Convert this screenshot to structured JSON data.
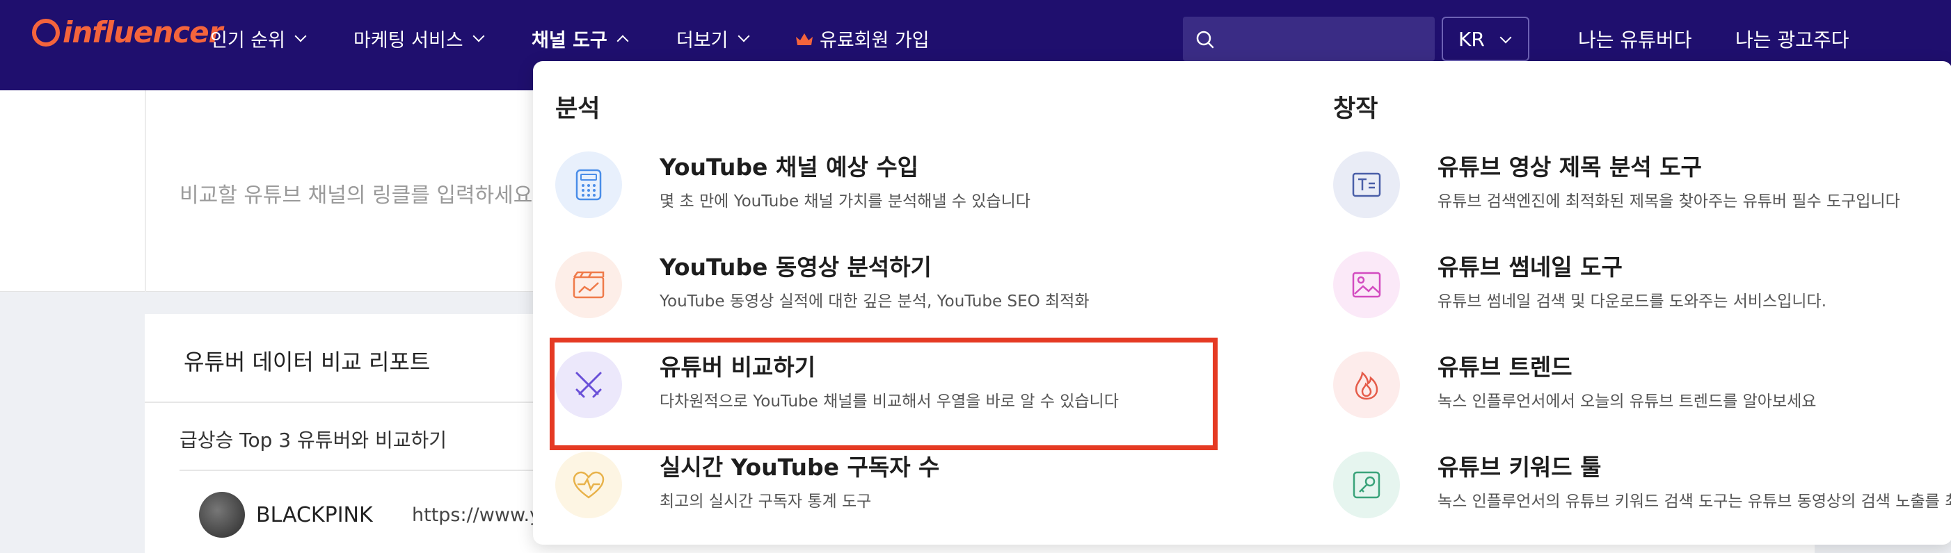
{
  "header": {
    "logo_text": "influencer",
    "nav": [
      {
        "label": "인기 순위"
      },
      {
        "label": "마케팅 서비스"
      },
      {
        "label": "채널 도구"
      },
      {
        "label": "더보기"
      },
      {
        "label": "유료회원 가입"
      }
    ],
    "search": {
      "placeholder": "",
      "value": ""
    },
    "language": "KR",
    "links": [
      "나는 유튜버다",
      "나는 광고주다"
    ]
  },
  "page": {
    "hero_placeholder": "비교할 유튜브 채널의 링클를 입력하세요",
    "report_title": "유튜버 데이터 비교 리포트",
    "report_subtitle": "급상승 Top 3 유튜버와 비교하기",
    "channel": {
      "name": "BLACKPINK",
      "url": "https://www.yo"
    }
  },
  "dropdown": {
    "analysis": {
      "title": "분석",
      "items": [
        {
          "title": "YouTube 채널 예상 수입",
          "desc": "몇 초 만에 YouTube 채널 가치를 분석해낼 수 있습니다",
          "icon": "calculator-icon"
        },
        {
          "title": "YouTube 동영상 분석하기",
          "desc": "YouTube 동영상 실적에 대한 깊은 분석, YouTube SEO 최적화",
          "icon": "video-chart-icon"
        },
        {
          "title": "유튜버 비교하기",
          "desc": "다차원적으로 YouTube 채널를 비교해서 우열을 바로 알 수 있습니다",
          "icon": "crossed-swords-icon"
        },
        {
          "title": "실시간 YouTube 구독자 수",
          "desc": "최고의 실시간 구독자 통계 도구",
          "icon": "heart-pulse-icon"
        }
      ]
    },
    "creation": {
      "title": "창작",
      "items": [
        {
          "title": "유튜브 영상 제목 분석 도구",
          "desc": "유튜브 검색엔진에 최적화된 제목을 찾아주는 유튜버 필수 도구입니다",
          "icon": "title-text-icon"
        },
        {
          "title": "유튜브 썸네일 도구",
          "desc": "유튜브 썸네일 검색 및 다운로드를 도와주는 서비스입니다.",
          "icon": "image-icon"
        },
        {
          "title": "유튜브 트렌드",
          "desc": "녹스 인플루언서에서 오늘의 유튜브 트렌드를 알아보세요",
          "icon": "flame-icon"
        },
        {
          "title": "유튜브 키워드 툴",
          "desc": "녹스 인플루언서의 유튜브 키워드 검색 도구는 유튜브 동영상의 검색 노출를 최",
          "icon": "key-icon"
        }
      ]
    }
  },
  "colors": {
    "nav_bg": "#1f0f6e",
    "logo": "#f4643c",
    "highlight": "#e53a23"
  }
}
